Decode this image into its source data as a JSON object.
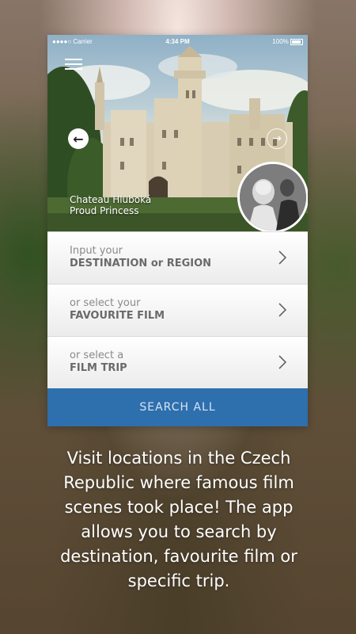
{
  "statusbar": {
    "carrier": "●●●●○ Carrier",
    "time": "4:34 PM",
    "battery": "100%"
  },
  "hero": {
    "location_name": "Chateau Hluboká",
    "film_name": "Proud Princess",
    "icons": [
      "menu-icon",
      "arrow-left-icon",
      "arrow-right-icon"
    ]
  },
  "menu": {
    "destination": {
      "line1": "Input your",
      "line2": "DESTINATION or REGION"
    },
    "film": {
      "line1": "or select your",
      "line2": "FAVOURITE FILM"
    },
    "trip": {
      "line1": "or select a",
      "line2": "FILM TRIP"
    }
  },
  "search_button": "SEARCH ALL",
  "description": "Visit locations in the Czech Republic where famous film scenes took place! The app allows you to search by destination, favourite film or specific trip.",
  "colors": {
    "accent": "#2e6fae",
    "search_text": "#d6e4f2"
  }
}
